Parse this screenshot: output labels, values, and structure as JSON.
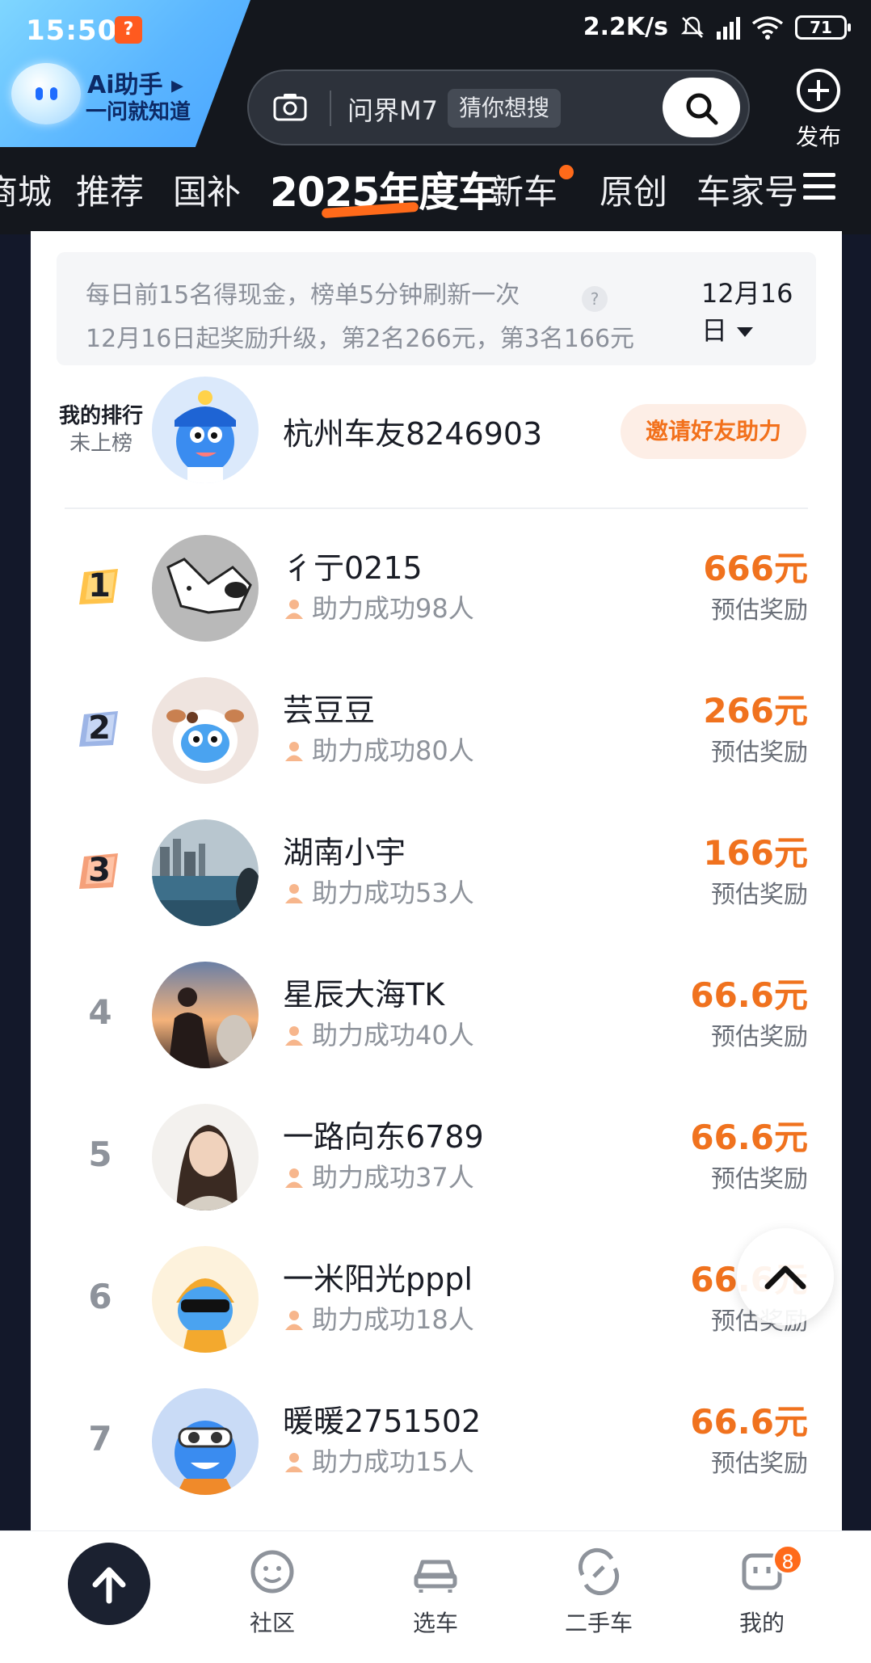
{
  "status_bar": {
    "time": "15:50",
    "app_badge": "?",
    "net_speed": "2.2K/s",
    "battery": "71"
  },
  "ai_assistant": {
    "title": "Ai助手 ▸",
    "subtitle": "一问就知道"
  },
  "search": {
    "query": "问界M7",
    "chip": "猜你想搜"
  },
  "publish_label": "发布",
  "tabs": [
    "商城",
    "推荐",
    "国补",
    "2025年度车",
    "新车",
    "原创",
    "车家号"
  ],
  "notice": {
    "line1": "每日前15名得现金，榜单5分钟刷新一次",
    "line2": "12月16日起奖励升级，第2名266元，第3名166元",
    "help": "?",
    "date": "12月16日"
  },
  "my_rank": {
    "label": "我的排行",
    "status": "未上榜",
    "name": "杭州车友8246903",
    "invite_button": "邀请好友助力"
  },
  "ranking": [
    {
      "rank": "1",
      "name": "彳亍0215",
      "helped": "助力成功98人",
      "reward": "666元",
      "reward_label": "预估奖励"
    },
    {
      "rank": "2",
      "name": "芸豆豆",
      "helped": "助力成功80人",
      "reward": "266元",
      "reward_label": "预估奖励"
    },
    {
      "rank": "3",
      "name": "湖南小宇",
      "helped": "助力成功53人",
      "reward": "166元",
      "reward_label": "预估奖励"
    },
    {
      "rank": "4",
      "name": "星辰大海TK",
      "helped": "助力成功40人",
      "reward": "66.6元",
      "reward_label": "预估奖励"
    },
    {
      "rank": "5",
      "name": "一路向东6789",
      "helped": "助力成功37人",
      "reward": "66.6元",
      "reward_label": "预估奖励"
    },
    {
      "rank": "6",
      "name": "一米阳光pppl",
      "helped": "助力成功18人",
      "reward": "66.6元",
      "reward_label": "预估奖励"
    },
    {
      "rank": "7",
      "name": "暖暖2751502",
      "helped": "助力成功15人",
      "reward": "66.6元",
      "reward_label": "预估奖励"
    }
  ],
  "bottom_nav": {
    "community": "社区",
    "choose_car": "选车",
    "used_car": "二手车",
    "mine": "我的",
    "mine_badge": "8"
  },
  "colors": {
    "accent_orange": "#f0721e",
    "header_bg": "#14171d",
    "ai_badge_blue": "#5bb6ff"
  }
}
